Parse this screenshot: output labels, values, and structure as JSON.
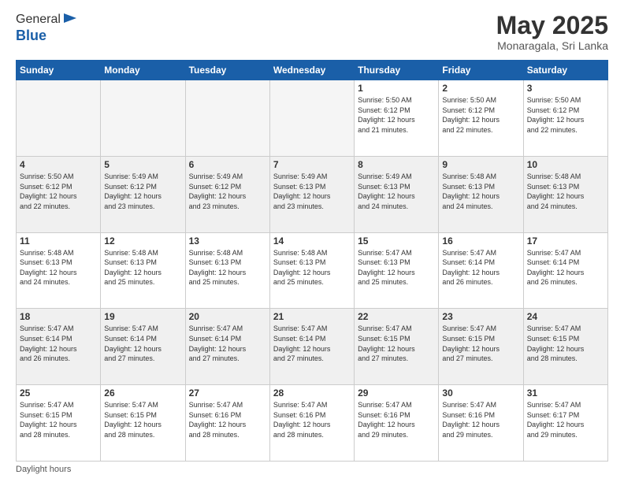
{
  "logo": {
    "general": "General",
    "blue": "Blue"
  },
  "header": {
    "month": "May 2025",
    "location": "Monaragala, Sri Lanka"
  },
  "days_of_week": [
    "Sunday",
    "Monday",
    "Tuesday",
    "Wednesday",
    "Thursday",
    "Friday",
    "Saturday"
  ],
  "footer": {
    "daylight_note": "Daylight hours"
  },
  "weeks": [
    [
      {
        "day": "",
        "info": ""
      },
      {
        "day": "",
        "info": ""
      },
      {
        "day": "",
        "info": ""
      },
      {
        "day": "",
        "info": ""
      },
      {
        "day": "1",
        "info": "Sunrise: 5:50 AM\nSunset: 6:12 PM\nDaylight: 12 hours\nand 21 minutes."
      },
      {
        "day": "2",
        "info": "Sunrise: 5:50 AM\nSunset: 6:12 PM\nDaylight: 12 hours\nand 22 minutes."
      },
      {
        "day": "3",
        "info": "Sunrise: 5:50 AM\nSunset: 6:12 PM\nDaylight: 12 hours\nand 22 minutes."
      }
    ],
    [
      {
        "day": "4",
        "info": "Sunrise: 5:50 AM\nSunset: 6:12 PM\nDaylight: 12 hours\nand 22 minutes."
      },
      {
        "day": "5",
        "info": "Sunrise: 5:49 AM\nSunset: 6:12 PM\nDaylight: 12 hours\nand 23 minutes."
      },
      {
        "day": "6",
        "info": "Sunrise: 5:49 AM\nSunset: 6:12 PM\nDaylight: 12 hours\nand 23 minutes."
      },
      {
        "day": "7",
        "info": "Sunrise: 5:49 AM\nSunset: 6:13 PM\nDaylight: 12 hours\nand 23 minutes."
      },
      {
        "day": "8",
        "info": "Sunrise: 5:49 AM\nSunset: 6:13 PM\nDaylight: 12 hours\nand 24 minutes."
      },
      {
        "day": "9",
        "info": "Sunrise: 5:48 AM\nSunset: 6:13 PM\nDaylight: 12 hours\nand 24 minutes."
      },
      {
        "day": "10",
        "info": "Sunrise: 5:48 AM\nSunset: 6:13 PM\nDaylight: 12 hours\nand 24 minutes."
      }
    ],
    [
      {
        "day": "11",
        "info": "Sunrise: 5:48 AM\nSunset: 6:13 PM\nDaylight: 12 hours\nand 24 minutes."
      },
      {
        "day": "12",
        "info": "Sunrise: 5:48 AM\nSunset: 6:13 PM\nDaylight: 12 hours\nand 25 minutes."
      },
      {
        "day": "13",
        "info": "Sunrise: 5:48 AM\nSunset: 6:13 PM\nDaylight: 12 hours\nand 25 minutes."
      },
      {
        "day": "14",
        "info": "Sunrise: 5:48 AM\nSunset: 6:13 PM\nDaylight: 12 hours\nand 25 minutes."
      },
      {
        "day": "15",
        "info": "Sunrise: 5:47 AM\nSunset: 6:13 PM\nDaylight: 12 hours\nand 25 minutes."
      },
      {
        "day": "16",
        "info": "Sunrise: 5:47 AM\nSunset: 6:14 PM\nDaylight: 12 hours\nand 26 minutes."
      },
      {
        "day": "17",
        "info": "Sunrise: 5:47 AM\nSunset: 6:14 PM\nDaylight: 12 hours\nand 26 minutes."
      }
    ],
    [
      {
        "day": "18",
        "info": "Sunrise: 5:47 AM\nSunset: 6:14 PM\nDaylight: 12 hours\nand 26 minutes."
      },
      {
        "day": "19",
        "info": "Sunrise: 5:47 AM\nSunset: 6:14 PM\nDaylight: 12 hours\nand 27 minutes."
      },
      {
        "day": "20",
        "info": "Sunrise: 5:47 AM\nSunset: 6:14 PM\nDaylight: 12 hours\nand 27 minutes."
      },
      {
        "day": "21",
        "info": "Sunrise: 5:47 AM\nSunset: 6:14 PM\nDaylight: 12 hours\nand 27 minutes."
      },
      {
        "day": "22",
        "info": "Sunrise: 5:47 AM\nSunset: 6:15 PM\nDaylight: 12 hours\nand 27 minutes."
      },
      {
        "day": "23",
        "info": "Sunrise: 5:47 AM\nSunset: 6:15 PM\nDaylight: 12 hours\nand 27 minutes."
      },
      {
        "day": "24",
        "info": "Sunrise: 5:47 AM\nSunset: 6:15 PM\nDaylight: 12 hours\nand 28 minutes."
      }
    ],
    [
      {
        "day": "25",
        "info": "Sunrise: 5:47 AM\nSunset: 6:15 PM\nDaylight: 12 hours\nand 28 minutes."
      },
      {
        "day": "26",
        "info": "Sunrise: 5:47 AM\nSunset: 6:15 PM\nDaylight: 12 hours\nand 28 minutes."
      },
      {
        "day": "27",
        "info": "Sunrise: 5:47 AM\nSunset: 6:16 PM\nDaylight: 12 hours\nand 28 minutes."
      },
      {
        "day": "28",
        "info": "Sunrise: 5:47 AM\nSunset: 6:16 PM\nDaylight: 12 hours\nand 28 minutes."
      },
      {
        "day": "29",
        "info": "Sunrise: 5:47 AM\nSunset: 6:16 PM\nDaylight: 12 hours\nand 29 minutes."
      },
      {
        "day": "30",
        "info": "Sunrise: 5:47 AM\nSunset: 6:16 PM\nDaylight: 12 hours\nand 29 minutes."
      },
      {
        "day": "31",
        "info": "Sunrise: 5:47 AM\nSunset: 6:17 PM\nDaylight: 12 hours\nand 29 minutes."
      }
    ]
  ]
}
